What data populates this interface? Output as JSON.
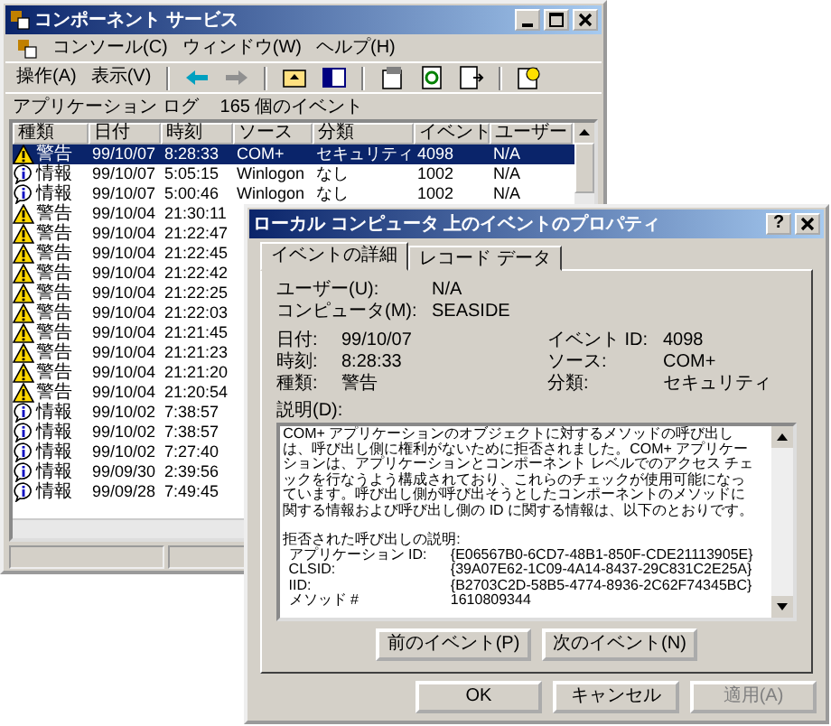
{
  "main_window": {
    "title": "コンポーネント サービス",
    "menu": [
      "コンソール(C)",
      "ウィンドウ(W)",
      "ヘルプ(H)"
    ],
    "toolbar": [
      "操作(A)",
      "表示(V)"
    ],
    "log_info": [
      "アプリケーション ログ",
      "165 個のイベント"
    ],
    "columns": [
      "種類",
      "日付",
      "時刻",
      "ソース",
      "分類",
      "イベント",
      "ユーザー"
    ],
    "rows": [
      {
        "kind": "warning",
        "selected": true,
        "cells": [
          "警告",
          "99/10/07",
          "8:28:33",
          "COM+",
          "セキュリティ",
          "4098",
          "N/A"
        ]
      },
      {
        "kind": "info",
        "selected": false,
        "cells": [
          "情報",
          "99/10/07",
          "5:05:15",
          "Winlogon",
          "なし",
          "1002",
          "N/A"
        ]
      },
      {
        "kind": "info",
        "selected": false,
        "cells": [
          "情報",
          "99/10/07",
          "5:00:46",
          "Winlogon",
          "なし",
          "1002",
          "N/A"
        ]
      },
      {
        "kind": "warning",
        "selected": false,
        "cells": [
          "警告",
          "99/10/04",
          "21:30:11"
        ]
      },
      {
        "kind": "warning",
        "selected": false,
        "cells": [
          "警告",
          "99/10/04",
          "21:22:47"
        ]
      },
      {
        "kind": "warning",
        "selected": false,
        "cells": [
          "警告",
          "99/10/04",
          "21:22:45"
        ]
      },
      {
        "kind": "warning",
        "selected": false,
        "cells": [
          "警告",
          "99/10/04",
          "21:22:42"
        ]
      },
      {
        "kind": "warning",
        "selected": false,
        "cells": [
          "警告",
          "99/10/04",
          "21:22:25"
        ]
      },
      {
        "kind": "warning",
        "selected": false,
        "cells": [
          "警告",
          "99/10/04",
          "21:22:03"
        ]
      },
      {
        "kind": "warning",
        "selected": false,
        "cells": [
          "警告",
          "99/10/04",
          "21:21:45"
        ]
      },
      {
        "kind": "warning",
        "selected": false,
        "cells": [
          "警告",
          "99/10/04",
          "21:21:23"
        ]
      },
      {
        "kind": "warning",
        "selected": false,
        "cells": [
          "警告",
          "99/10/04",
          "21:21:20"
        ]
      },
      {
        "kind": "warning",
        "selected": false,
        "cells": [
          "警告",
          "99/10/04",
          "21:20:54"
        ]
      },
      {
        "kind": "info",
        "selected": false,
        "cells": [
          "情報",
          "99/10/02",
          "7:38:57"
        ]
      },
      {
        "kind": "info",
        "selected": false,
        "cells": [
          "情報",
          "99/10/02",
          "7:38:57"
        ]
      },
      {
        "kind": "info",
        "selected": false,
        "cells": [
          "情報",
          "99/10/02",
          "7:27:40"
        ]
      },
      {
        "kind": "info",
        "selected": false,
        "cells": [
          "情報",
          "99/09/30",
          "2:39:56"
        ]
      },
      {
        "kind": "info",
        "selected": false,
        "cells": [
          "情報",
          "99/09/28",
          "7:49:45"
        ]
      }
    ]
  },
  "dialog": {
    "title": "ローカル コンピュータ 上のイベントのプロパティ",
    "help": "?",
    "tabs": [
      {
        "label": "イベントの詳細",
        "selected": true
      },
      {
        "label": "レコード データ",
        "selected": false
      }
    ],
    "user": {
      "label": "ユーザー(U):",
      "value": "N/A"
    },
    "computer": {
      "label": "コンピュータ(M):",
      "value": "SEASIDE"
    },
    "fields": [
      [
        {
          "label": "日付:",
          "value": "99/10/07"
        },
        {
          "label": "イベント ID:",
          "value": "4098"
        }
      ],
      [
        {
          "label": "時刻:",
          "value": "8:28:33"
        },
        {
          "label": "ソース:",
          "value": "COM+"
        }
      ],
      [
        {
          "label": "種類:",
          "value": "警告"
        },
        {
          "label": "分類:",
          "value": "セキュリティ"
        }
      ]
    ],
    "description_label": "説明(D):",
    "description": "COM+ アプリケーションのオブジェクトに対するメソッドの呼び出しは、呼び出し側に権利がないために拒否されました。COM+ アプリケーションは、アプリケーションとコンポーネント レベルでのアクセス チェックを行なうよう構成されており、これらのチェックが使用可能になっています。呼び出し側が呼び出そうとしたコンポーネントのメソッドに関する情報および呼び出し側の ID に関する情報は、以下のとおりです。",
    "details_title": "拒否された呼び出しの説明:",
    "details": [
      {
        "label": "アプリケーション ID:",
        "value": "{E06567B0-6CD7-48B1-850F-CDE21113905E}"
      },
      {
        "label": "CLSID:",
        "value": "{39A07E62-1C09-4A14-8437-29C831C2E25A}"
      },
      {
        "label": "IID:",
        "value": "{B2703C2D-58B5-4774-8936-2C62F74345BC}"
      },
      {
        "label": "メソッド #",
        "value": "1610809344"
      }
    ],
    "nav_buttons": [
      "前のイベント(P)",
      "次のイベント(N)"
    ],
    "buttons": [
      {
        "label": "OK",
        "disabled": false
      },
      {
        "label": "キャンセル",
        "disabled": false
      },
      {
        "label": "適用(A)",
        "disabled": true
      }
    ]
  }
}
